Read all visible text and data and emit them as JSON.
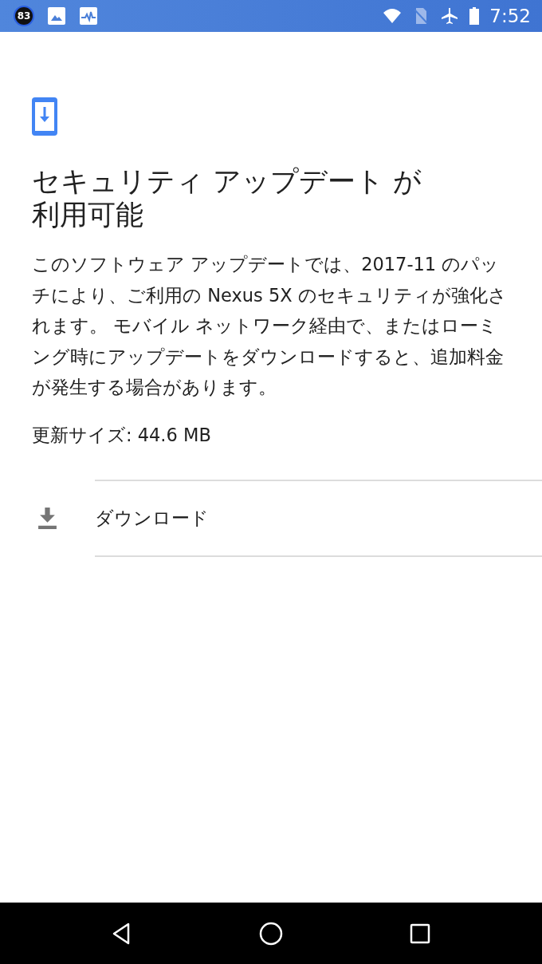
{
  "status_bar": {
    "badge": "83",
    "time": "7:52"
  },
  "title": "セキュリティ アップデート が利用可能",
  "description": "このソフトウェア アップデートでは、2017-11 のパッチにより、ご利用の Nexus 5X のセキュリティが強化されます。 モバイル ネットワーク経由で、またはローミング時にアップデートをダウンロードすると、追加料金が発生する場合があります。",
  "update_size": "更新サイズ: 44.6 MB",
  "actions": [
    {
      "label": "ダウンロード"
    }
  ]
}
